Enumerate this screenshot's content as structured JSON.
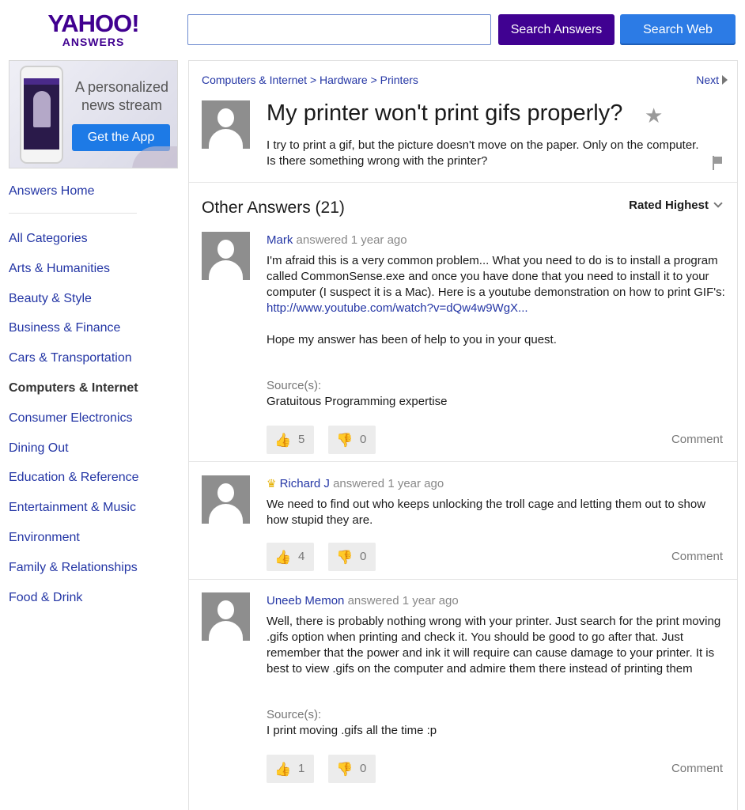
{
  "header": {
    "logo_main": "YAHOO!",
    "logo_sub": "ANSWERS",
    "search_placeholder": "",
    "btn_answers": "Search Answers",
    "btn_web": "Search Web"
  },
  "ad": {
    "text": "A personalized news stream",
    "cta": "Get the App"
  },
  "sidebar": {
    "home": "Answers Home",
    "categories": [
      "All Categories",
      "Arts & Humanities",
      "Beauty & Style",
      "Business & Finance",
      "Cars & Transportation",
      "Computers & Internet",
      "Consumer Electronics",
      "Dining Out",
      "Education & Reference",
      "Entertainment & Music",
      "Environment",
      "Family & Relationships",
      "Food & Drink"
    ]
  },
  "question": {
    "breadcrumb": "Computers & Internet > Hardware > Printers",
    "next": "Next",
    "title": "My printer won't print gifs properly?",
    "body": "I try to print a gif, but the picture doesn't move on the paper. Only on the computer. Is there something wrong with the printer?"
  },
  "answers_header": {
    "title": "Other Answers (21)",
    "sort": "Rated Highest"
  },
  "answers": [
    {
      "name": "Mark",
      "answered": "answered",
      "time": "1 year ago",
      "text_before_link": "I'm afraid this is a very common problem... What you need to do is to install a program called CommonSense.exe and once you have done that you need to install it to your computer (I suspect it is a Mac). Here is a youtube demonstration on how to print GIF's: ",
      "link": "http://www.youtube.com/watch?v=dQw4w9WgX...",
      "text_after": "Hope my answer has been of help to you in your quest.",
      "source_label": "Source(s):",
      "source": "Gratuitous Programming expertise",
      "up": "5",
      "down": "0",
      "comment": "Comment"
    },
    {
      "name": "Richard J",
      "answered": "answered",
      "time": "1 year ago",
      "text": "We need to find out who keeps unlocking the troll cage and letting them out to show how stupid they are.",
      "up": "4",
      "down": "0",
      "comment": "Comment"
    },
    {
      "name": "Uneeb Memon",
      "answered": "answered",
      "time": "1 year ago",
      "text": "Well, there is probably nothing wrong with your printer. Just search for the print moving .gifs option when printing and check it. You should be good to go after that. Just remember that the power and ink it will require can cause damage to your printer. It is best to view .gifs on the computer and admire them there instead of printing them",
      "source_label": "Source(s):",
      "source": "I print moving .gifs all the time :p",
      "up": "1",
      "down": "0",
      "comment": "Comment"
    }
  ]
}
